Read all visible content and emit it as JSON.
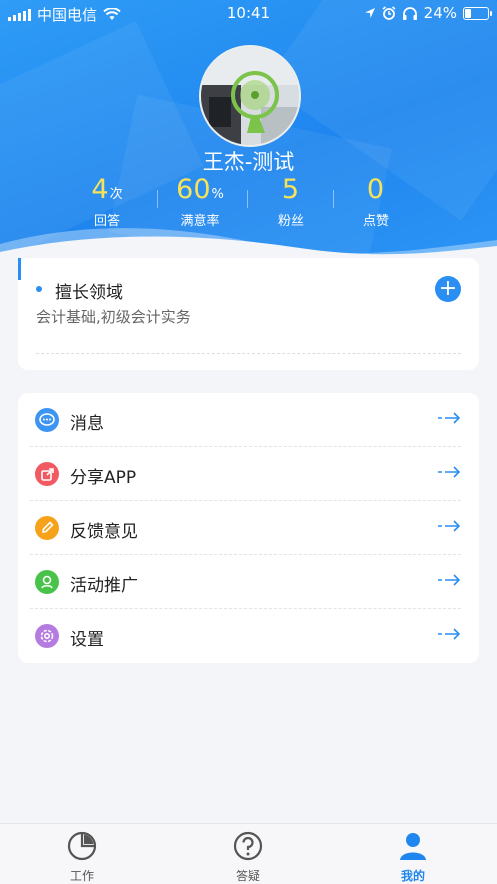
{
  "status_bar": {
    "carrier": "中国电信",
    "time": "10:41",
    "battery": "24%"
  },
  "profile": {
    "name": "王杰-测试",
    "stats": [
      {
        "value": "4",
        "unit": "次",
        "label": "回答"
      },
      {
        "value": "60",
        "unit": "%",
        "label": "满意率"
      },
      {
        "value": "5",
        "unit": "",
        "label": "粉丝"
      },
      {
        "value": "0",
        "unit": "",
        "label": "点赞"
      }
    ]
  },
  "expertise": {
    "title": "擅长领域",
    "areas": "会计基础,初级会计实务",
    "add_icon": "plus-circle-icon"
  },
  "menu": {
    "items": [
      {
        "label": "消息",
        "icon": "message-icon",
        "color": "#3d95f3"
      },
      {
        "label": "分享APP",
        "icon": "share-icon",
        "color": "#f25a63"
      },
      {
        "label": "反馈意见",
        "icon": "pencil-icon",
        "color": "#f7a21b"
      },
      {
        "label": "活动推广",
        "icon": "user-icon",
        "color": "#49c24a"
      },
      {
        "label": "设置",
        "icon": "gear-icon",
        "color": "#b57be0"
      }
    ]
  },
  "tabbar": {
    "tabs": [
      {
        "label": "工作",
        "icon": "pie-chart-icon"
      },
      {
        "label": "答疑",
        "icon": "question-icon"
      },
      {
        "label": "我的",
        "icon": "person-icon",
        "active": true
      }
    ]
  },
  "colors": {
    "primary": "#1f86ef",
    "stat_number": "#f6e35a"
  }
}
